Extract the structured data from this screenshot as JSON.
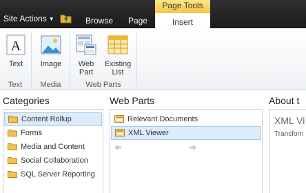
{
  "topbar": {
    "site_actions": "Site Actions",
    "nav_icon": "navigate-up-folder-icon",
    "tabs": [
      "Browse",
      "Page"
    ],
    "context_group": "Page Tools",
    "active_tab": "Insert"
  },
  "ribbon": {
    "buttons": [
      {
        "label": "Text",
        "icon": "text-icon"
      },
      {
        "label": "Image",
        "icon": "image-icon"
      },
      {
        "label_line1": "Web",
        "label_line2": "Part",
        "icon": "web-part-icon"
      },
      {
        "label_line1": "Existing",
        "label_line2": "List",
        "icon": "existing-list-icon"
      }
    ],
    "groups": [
      "Text",
      "Media",
      "Web Parts"
    ]
  },
  "categories": {
    "title": "Categories",
    "items": [
      "Content Rollup",
      "Forms",
      "Media and Content",
      "Social Collaboration",
      "SQL Server Reporting"
    ],
    "selected": "Content Rollup"
  },
  "web_parts": {
    "title": "Web Parts",
    "items": [
      "Relevant Documents",
      "XML Viewer"
    ],
    "selected": "XML Viewer"
  },
  "about": {
    "title": "About t",
    "part_name": "XML Vi",
    "description": "Transforn"
  },
  "colors": {
    "topbar": "#1f1f1f",
    "context_tab": "#f7c949",
    "selection": "#dcebfa"
  }
}
